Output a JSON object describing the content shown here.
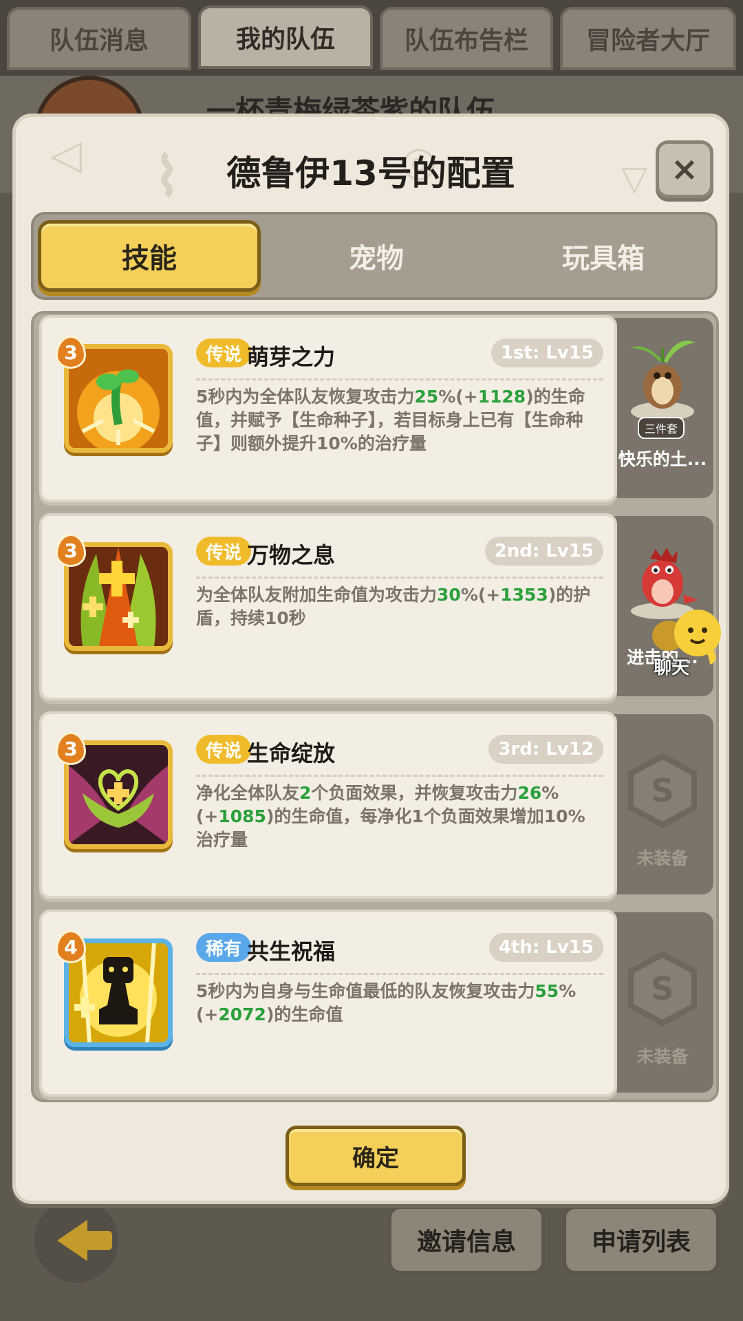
{
  "background": {
    "tabs": [
      "队伍消息",
      "我的队伍",
      "队伍布告栏",
      "冒险者大厅"
    ],
    "active_tab": "我的队伍",
    "team_title": "一杯青梅绿茶紫的队伍",
    "footer_buttons": [
      "邀请信息",
      "申请列表"
    ]
  },
  "modal": {
    "title": "德鲁伊13号的配置",
    "close_icon": "×",
    "tabs": [
      "技能",
      "宠物",
      "玩具箱"
    ],
    "active_tab": "技能",
    "confirm_label": "确定"
  },
  "skills": [
    {
      "level": "3",
      "rarity": "传说",
      "name": "萌芽之力",
      "slot": "1st: Lv15",
      "desc_parts": [
        "5秒内为全体队友恢复攻击力",
        "25",
        "%(+",
        "1128",
        ")的生命值，并赋予【生命种子】，若目标身上已有【生命种子】则额外提升10%的治疗量"
      ],
      "icon": "sprout-icon"
    },
    {
      "level": "3",
      "rarity": "传说",
      "name": "万物之息",
      "slot": "2nd: Lv15",
      "desc_parts": [
        "为全体队友附加生命值为攻击力",
        "30",
        "%(+",
        "1353",
        ")的护盾，持续10秒"
      ],
      "icon": "plus-flame-icon"
    },
    {
      "level": "3",
      "rarity": "传说",
      "name": "生命绽放",
      "slot": "3rd: Lv12",
      "desc_parts": [
        "净化全体队友",
        "2",
        "个负面效果，并恢复攻击力",
        "26",
        "%(+",
        "1085",
        ")的生命值，每净化1个负面效果增加10%治疗量"
      ],
      "icon": "heart-flower-icon"
    },
    {
      "level": "4",
      "rarity": "稀有",
      "name": "共生祝福",
      "slot": "4th: Lv15",
      "desc_parts": [
        "5秒内为自身与生命值最低的队友恢复攻击力",
        "55",
        "%(+",
        "2072",
        ")的生命值"
      ],
      "icon": "symbiosis-icon"
    }
  ],
  "side_slots": [
    {
      "type": "pet",
      "name": "快乐的土...",
      "tag": "三件套"
    },
    {
      "type": "pet",
      "name": "进击的..."
    },
    {
      "type": "empty",
      "label": "未装备"
    },
    {
      "type": "empty",
      "label": "未装备"
    }
  ],
  "chat": {
    "label": "聊天"
  }
}
